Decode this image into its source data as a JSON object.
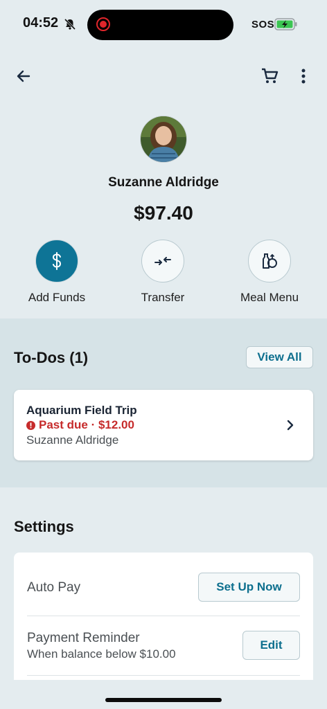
{
  "status_bar": {
    "time": "04:52",
    "sos": "SOS"
  },
  "header": {
    "back_icon": "arrow-left-icon",
    "cart_icon": "cart-icon",
    "more_icon": "more-vertical-icon"
  },
  "profile": {
    "name": "Suzanne Aldridge",
    "balance": "$97.40"
  },
  "actions": [
    {
      "label": "Add Funds",
      "icon": "dollar-icon"
    },
    {
      "label": "Transfer",
      "icon": "transfer-icon"
    },
    {
      "label": "Meal Menu",
      "icon": "meal-menu-icon"
    }
  ],
  "todos": {
    "title": "To-Dos (1)",
    "view_all": "View All",
    "item": {
      "title": "Aquarium Field Trip",
      "status": "Past due · $12.00",
      "student": "Suzanne Aldridge"
    }
  },
  "settings": {
    "title": "Settings",
    "auto_pay": {
      "label": "Auto Pay",
      "button": "Set Up Now"
    },
    "payment_reminder": {
      "label": "Payment Reminder",
      "sub": "When balance below $10.00",
      "button": "Edit"
    }
  },
  "colors": {
    "accent": "#0d6f8e",
    "add_funds_bg": "#0e7496",
    "past_due": "#c62b2b",
    "background": "#e4ecef"
  }
}
